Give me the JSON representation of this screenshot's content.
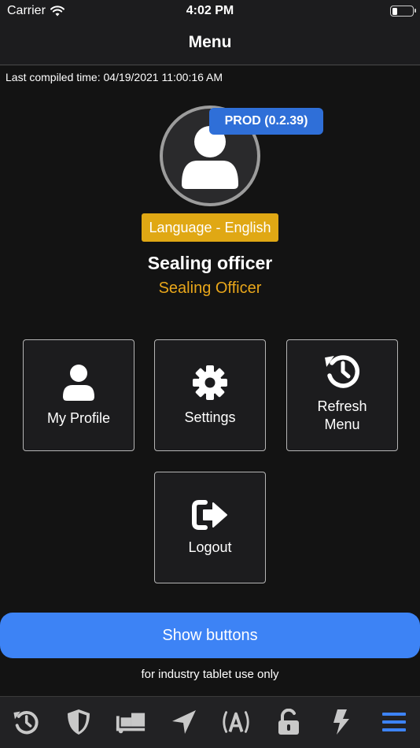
{
  "status_bar": {
    "carrier": "Carrier",
    "time": "4:02 PM",
    "battery_level": 0.25,
    "wifi_icon": "wifi-icon"
  },
  "nav": {
    "title": "Menu"
  },
  "compiled_time": "Last compiled time: 04/19/2021 11:00:16 AM",
  "profile": {
    "environment_badge": "PROD (0.2.39)",
    "language_badge": "Language - English",
    "name": "Sealing officer",
    "role": "Sealing Officer",
    "avatar_icon": "user-icon"
  },
  "tiles": [
    {
      "label": "My Profile",
      "icon": "user-icon"
    },
    {
      "label": "Settings",
      "icon": "gear-icon"
    },
    {
      "label": "Refresh Menu",
      "icon": "history-icon"
    },
    {
      "label": "Logout",
      "icon": "logout-icon"
    }
  ],
  "show_buttons_label": "Show buttons",
  "industry_note": "for industry tablet use only",
  "tab_bar": [
    {
      "icon": "history-icon"
    },
    {
      "icon": "shield-icon"
    },
    {
      "icon": "dolly-icon"
    },
    {
      "icon": "location-arrow-icon"
    },
    {
      "icon": "broadcast-a-icon"
    },
    {
      "icon": "unlock-icon"
    },
    {
      "icon": "bolt-icon"
    },
    {
      "icon": "menu-icon",
      "active": true
    }
  ],
  "colors": {
    "background": "#131313",
    "accent_blue": "#3d83f5",
    "env_badge": "#2f6fd8",
    "language_badge": "#e0a814",
    "role_text": "#e8a61a"
  }
}
